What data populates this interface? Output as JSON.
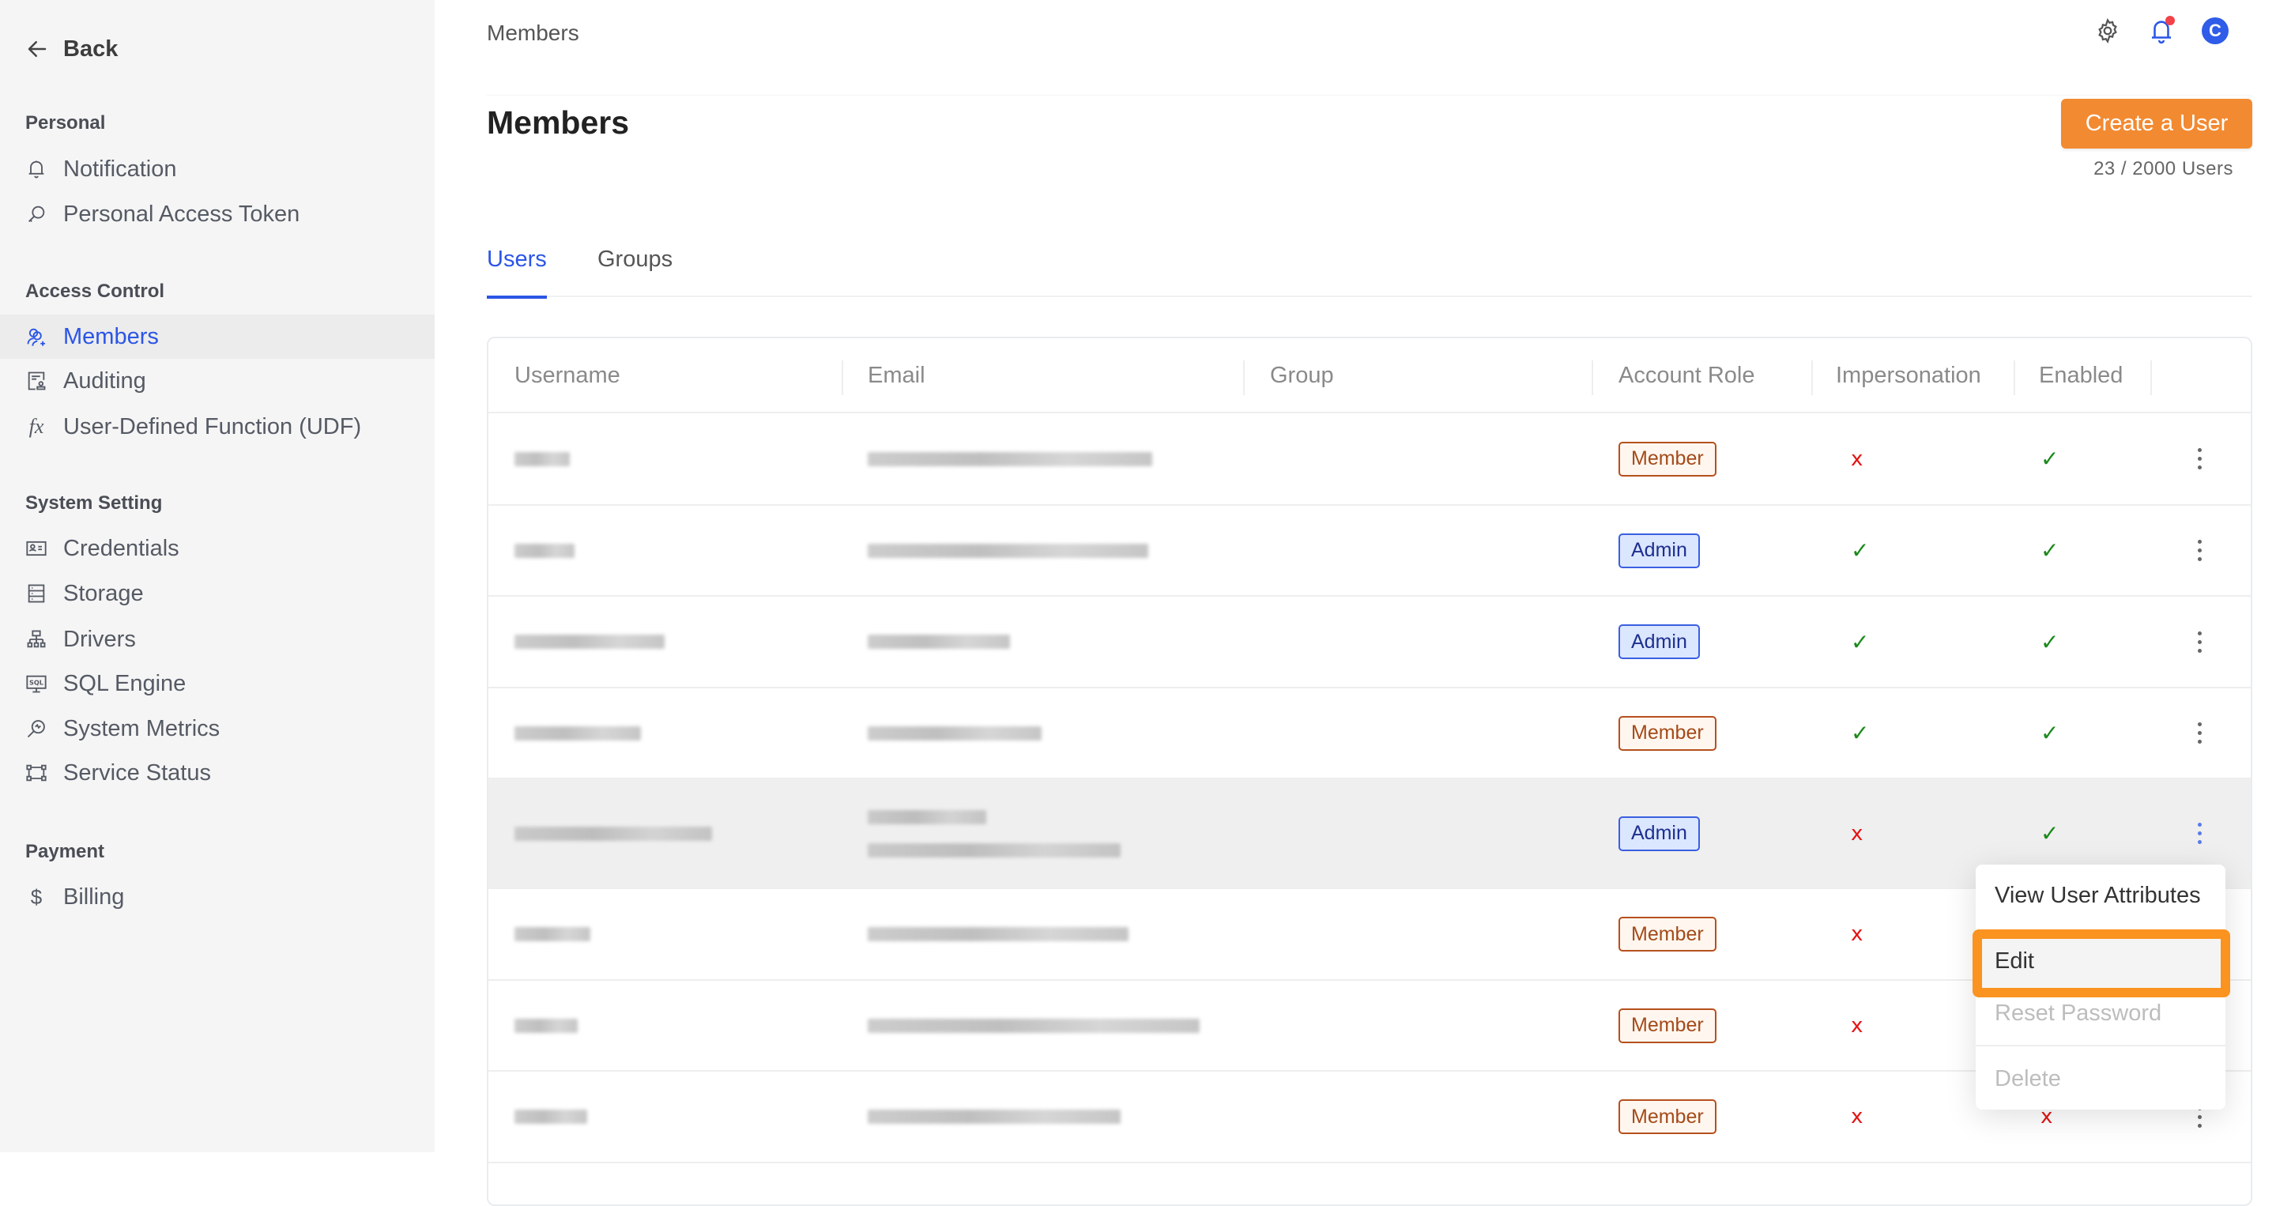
{
  "sidebar": {
    "back_label": "Back",
    "sections": [
      {
        "title": "Personal",
        "items": [
          {
            "label": "Notification",
            "icon": "bell-icon"
          },
          {
            "label": "Personal Access Token",
            "icon": "key-icon"
          }
        ]
      },
      {
        "title": "Access Control",
        "items": [
          {
            "label": "Members",
            "icon": "users-icon",
            "active": true
          },
          {
            "label": "Auditing",
            "icon": "audit-icon"
          },
          {
            "label": "User-Defined Function (UDF)",
            "icon": "fx-icon"
          }
        ]
      },
      {
        "title": "System Setting",
        "items": [
          {
            "label": "Credentials",
            "icon": "id-card-icon"
          },
          {
            "label": "Storage",
            "icon": "storage-icon"
          },
          {
            "label": "Drivers",
            "icon": "network-icon"
          },
          {
            "label": "SQL Engine",
            "icon": "sql-monitor-icon"
          },
          {
            "label": "System Metrics",
            "icon": "metrics-search-icon"
          },
          {
            "label": "Service Status",
            "icon": "frame-icon"
          }
        ]
      },
      {
        "title": "Payment",
        "items": [
          {
            "label": "Billing",
            "icon": "dollar-icon"
          }
        ]
      }
    ]
  },
  "header": {
    "breadcrumb": "Members",
    "avatar_initial": "C",
    "has_notification": true
  },
  "page": {
    "title": "Members",
    "create_button": "Create a User",
    "user_count": "23 / 2000 Users"
  },
  "tabs": [
    {
      "label": "Users",
      "active": true
    },
    {
      "label": "Groups",
      "active": false
    }
  ],
  "table": {
    "columns": [
      "Username",
      "Email",
      "Group",
      "Account Role",
      "Impersonation",
      "Enabled"
    ],
    "rows": [
      {
        "username": "[redacted]",
        "email": "[redacted]",
        "group": "",
        "role": "Member",
        "impersonation": false,
        "enabled": true
      },
      {
        "username": "[redacted]",
        "email": "[redacted]",
        "group": "",
        "role": "Admin",
        "impersonation": true,
        "enabled": true
      },
      {
        "username": "[redacted]",
        "email": "[redacted]",
        "group": "",
        "role": "Admin",
        "impersonation": true,
        "enabled": true
      },
      {
        "username": "[redacted]",
        "email": "[redacted]",
        "group": "",
        "role": "Member",
        "impersonation": true,
        "enabled": true
      },
      {
        "username": "[redacted]",
        "email": "[redacted]",
        "group": "",
        "role": "Admin",
        "impersonation": false,
        "enabled": true,
        "hovered": true
      },
      {
        "username": "[redacted]",
        "email": "[redacted]",
        "group": "",
        "role": "Member",
        "impersonation": false,
        "enabled": null
      },
      {
        "username": "[redacted]",
        "email": "[redacted]",
        "group": "",
        "role": "Member",
        "impersonation": false,
        "enabled": null
      },
      {
        "username": "[redacted]",
        "email": "[redacted]",
        "group": "",
        "role": "Member",
        "impersonation": false,
        "enabled": false
      }
    ],
    "marks": {
      "yes": "✓",
      "no": "x"
    }
  },
  "row_menu": {
    "items": [
      {
        "label": "View User Attributes",
        "disabled": false
      },
      {
        "label": "Edit",
        "disabled": false,
        "highlighted": true
      },
      {
        "label": "Reset Password",
        "disabled": true
      },
      {
        "label": "Delete",
        "disabled": true
      }
    ]
  },
  "colors": {
    "accent": "#2b55e6",
    "primary_button": "#f28a32",
    "highlight_outline": "#fa931f",
    "check": "#1a8a1a",
    "cross": "#e41313"
  }
}
